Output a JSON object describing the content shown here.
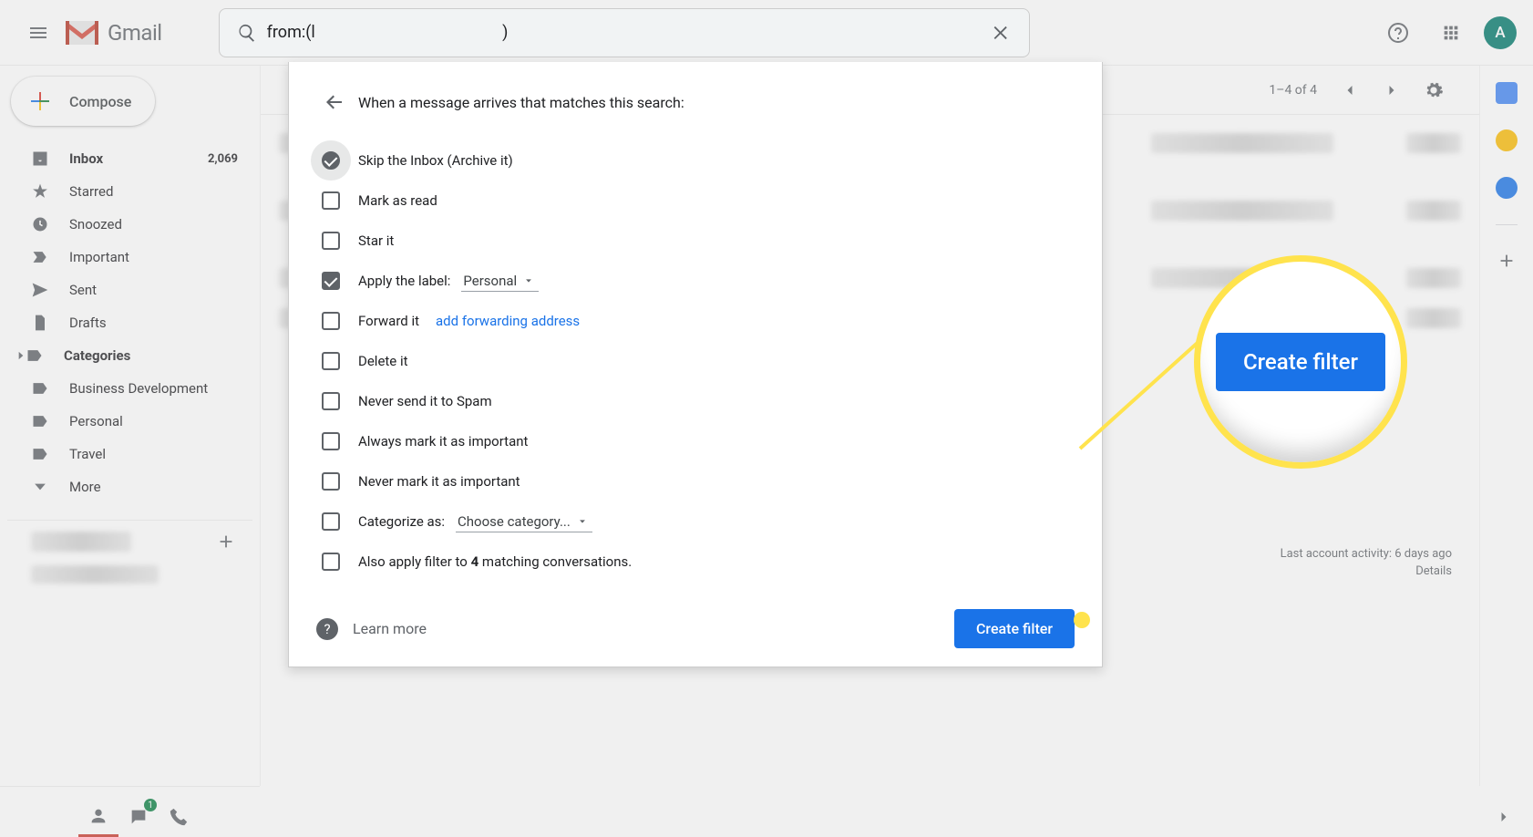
{
  "header": {
    "app_name": "Gmail",
    "search_value": "from:(l                                              )",
    "avatar_initial": "A"
  },
  "compose_label": "Compose",
  "sidebar": {
    "items": [
      {
        "label": "Inbox",
        "count": "2,069",
        "bold": true,
        "icon": "inbox"
      },
      {
        "label": "Starred",
        "icon": "star"
      },
      {
        "label": "Snoozed",
        "icon": "clock"
      },
      {
        "label": "Important",
        "icon": "important"
      },
      {
        "label": "Sent",
        "icon": "send"
      },
      {
        "label": "Drafts",
        "icon": "file"
      },
      {
        "label": "Categories",
        "bold": true,
        "icon": "label",
        "expandable": true
      },
      {
        "label": "Business Development",
        "icon": "label"
      },
      {
        "label": "Personal",
        "icon": "label"
      },
      {
        "label": "Travel",
        "icon": "label"
      },
      {
        "label": "More",
        "icon": "chevron-down"
      }
    ]
  },
  "toolbar": {
    "page_text": "1–4 of 4"
  },
  "activity": {
    "text": "Last account activity: 6 days ago",
    "details": "Details"
  },
  "filter": {
    "title": "When a message arrives that matches this search:",
    "options": {
      "skip": "Skip the Inbox (Archive it)",
      "read": "Mark as read",
      "star": "Star it",
      "apply_label": "Apply the label:",
      "apply_label_value": "Personal",
      "forward": "Forward it",
      "forward_link": "add forwarding address",
      "delete": "Delete it",
      "never_spam": "Never send it to Spam",
      "always_important": "Always mark it as important",
      "never_important": "Never mark it as important",
      "categorize": "Categorize as:",
      "categorize_value": "Choose category...",
      "also_apply_pre": "Also apply filter to ",
      "also_apply_count": "4",
      "also_apply_post": " matching conversations."
    },
    "learn_more": "Learn more",
    "create": "Create filter"
  },
  "callout": {
    "label": "Create filter"
  },
  "contacts_badge": "1"
}
